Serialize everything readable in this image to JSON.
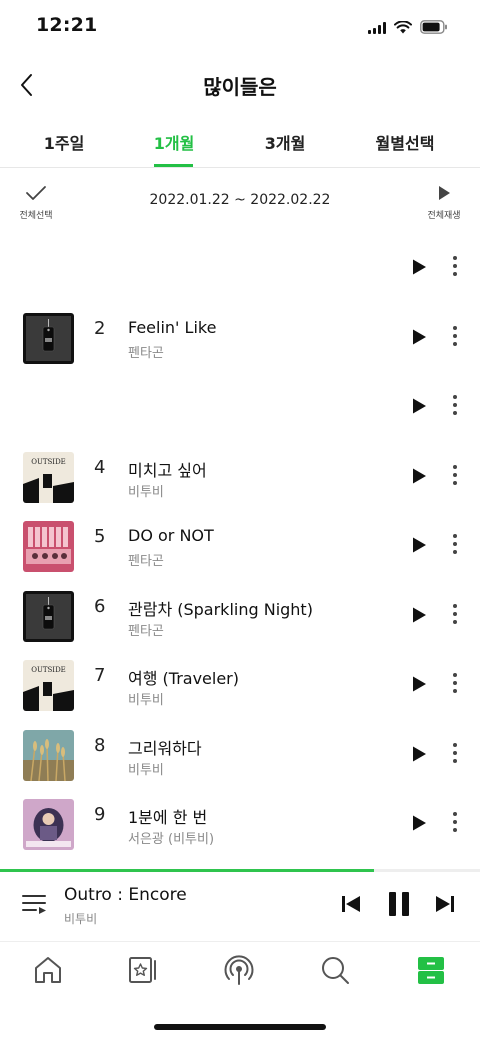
{
  "status_bar": {
    "time": "12:21"
  },
  "header": {
    "title": "많이들은"
  },
  "tabs": [
    {
      "label": "1주일"
    },
    {
      "label": "1개월"
    },
    {
      "label": "3개월"
    },
    {
      "label": "월별선택"
    }
  ],
  "active_tab": "1개월",
  "toolbar": {
    "select_all_label": "전체선택",
    "date_range": "2022.01.22 ~ 2022.02.22",
    "play_all_label": "전체재생"
  },
  "songs": [
    {
      "rank": "",
      "title": "",
      "artist": "",
      "cover": "none"
    },
    {
      "rank": "2",
      "title": "Feelin' Like",
      "artist": "펜타곤",
      "cover": "black-tag"
    },
    {
      "rank": "",
      "title": "",
      "artist": "",
      "cover": "none"
    },
    {
      "rank": "4",
      "title": "미치고 싶어",
      "artist": "비투비",
      "cover": "outside"
    },
    {
      "rank": "5",
      "title": "DO or NOT",
      "artist": "펜타곤",
      "cover": "pink"
    },
    {
      "rank": "6",
      "title": "관람차 (Sparkling Night)",
      "artist": "펜타곤",
      "cover": "black-tag"
    },
    {
      "rank": "7",
      "title": "여행 (Traveler)",
      "artist": "비투비",
      "cover": "outside"
    },
    {
      "rank": "8",
      "title": "그리워하다",
      "artist": "비투비",
      "cover": "reeds"
    },
    {
      "rank": "9",
      "title": "1분에 한 번",
      "artist": "서은광 (비투비)",
      "cover": "purple"
    }
  ],
  "now_playing": {
    "title": "Outro : Encore",
    "artist": "비투비",
    "progress": 0.78
  },
  "bottom_nav": [
    {
      "icon": "home-icon"
    },
    {
      "icon": "star-card-icon"
    },
    {
      "icon": "radio-icon"
    },
    {
      "icon": "search-icon"
    },
    {
      "icon": "locker-icon",
      "active": true
    }
  ],
  "colors": {
    "accent": "#23c045",
    "text": "#111111",
    "sub": "#8a8a8a"
  }
}
